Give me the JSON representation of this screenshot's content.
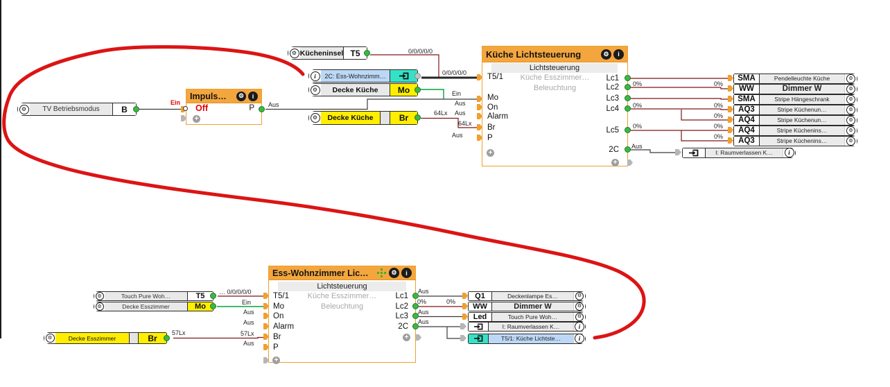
{
  "colors": {
    "block_header_orange": "#f4a63e",
    "block_border_orange": "#ef9f2e",
    "connector_orange": "#f0a030",
    "value_yellow": "#ffee00",
    "ref_cyan": "#36e2c6",
    "ref_blue": "#bcd8f6",
    "wire_red": "#7d1616",
    "wire_green": "#00a33a",
    "wire_black": "#3a3a3a",
    "annotation_red": "#dc1414",
    "led_green": "#3cb845"
  },
  "icons": {
    "gear": "⚙",
    "info": "i",
    "plus": "+"
  },
  "sources": {
    "tv": {
      "label": "TV Betriebsmodus",
      "value": "B"
    },
    "kuecheninsel": {
      "label": "Kücheninsel",
      "value": "T5"
    },
    "ref_2c": {
      "label": "2C: Ess-Wohnzimm…"
    },
    "decke_kueche_mo": {
      "label": "Decke Küche",
      "value": "Mo"
    },
    "decke_kueche_br": {
      "label": "Decke Küche",
      "value": "Br"
    },
    "touch_pure": {
      "label": "Touch Pure Woh…",
      "value": "T5"
    },
    "decke_esszimmer_mo": {
      "label": "Decke Esszimmer",
      "value": "Mo"
    },
    "decke_esszimmer_br": {
      "label": "Decke Esszimmer",
      "value": "Br"
    }
  },
  "blocks": {
    "impuls": {
      "title": "Impuls…",
      "input": "Off",
      "output": "P"
    },
    "kueche": {
      "title": "Küche Lichtsteuerung",
      "type": "Lichtsteuerung",
      "room": "Küche Esszimmer…",
      "category": "Beleuchtung",
      "inputs": [
        "T5/1",
        "Mo",
        "On",
        "Alarm",
        "Br",
        "P"
      ],
      "outputs": [
        "Lc1",
        "Lc2",
        "Lc3",
        "Lc4",
        "Lc5",
        "2C"
      ]
    },
    "esszimmer": {
      "title": "Ess-Wohnzimmer Lic…",
      "type": "Lichtsteuerung",
      "room": "Küche Esszimmer…",
      "category": "Beleuchtung",
      "inputs": [
        "T5/1",
        "Mo",
        "On",
        "Alarm",
        "Br",
        "P"
      ],
      "outputs": [
        "Lc1",
        "Lc2",
        "Lc3",
        "2C"
      ]
    }
  },
  "outputs_top": {
    "rows": [
      {
        "port": "SMA",
        "label": "Pendelleuchte Küche"
      },
      {
        "port": "WW",
        "label": "Dimmer W"
      },
      {
        "port": "SMA",
        "label": "Stripe Hängeschrank"
      },
      {
        "port": "AQ3",
        "label": "Stripe Küchenun…"
      },
      {
        "port": "AQ4",
        "label": "Stripe Küchenun…"
      },
      {
        "port": "AQ4",
        "label": "Stripe Küchenins…"
      },
      {
        "port": "AQ3",
        "label": "Stripe Küchenins…"
      }
    ],
    "ref": {
      "label": "I: Raumverlassen K…"
    }
  },
  "outputs_bottom": {
    "rows": [
      {
        "port": "Q1",
        "label": "Deckenlampe Es…"
      },
      {
        "port": "WW",
        "label": "Dimmer W"
      },
      {
        "port": "Led",
        "label": "Touch Pure Woh…"
      }
    ],
    "refs": [
      {
        "label": "I: Raumverlassen K…"
      },
      {
        "label": "T5/1: Küche Lichtste…"
      }
    ]
  },
  "wire_labels": {
    "tv_ein": "Ein",
    "impuls_aus": "Aus",
    "kuecheninsel_value": "0/0/0/0/0",
    "t5_top": "0/0/0/0/0",
    "mo_top": "Ein",
    "on_top": "Aus",
    "alarm_top": "Aus",
    "br_top_src": "64Lx",
    "br_top_dst": "64Lx",
    "p_top": "Aus",
    "pct0": "0%",
    "c2_top": "Aus",
    "t5_bottom": "… 0/0/0/0/0",
    "mo_bottom": "Ein",
    "on_bottom": "Aus",
    "alarm_bottom": "Aus",
    "br_bottom_src": "57Lx",
    "br_bottom_dst": "57Lx",
    "p_bottom": "Aus",
    "lc1_bottom": "Aus",
    "lc3_bottom": "Aus",
    "c2_bottom": "Aus"
  }
}
